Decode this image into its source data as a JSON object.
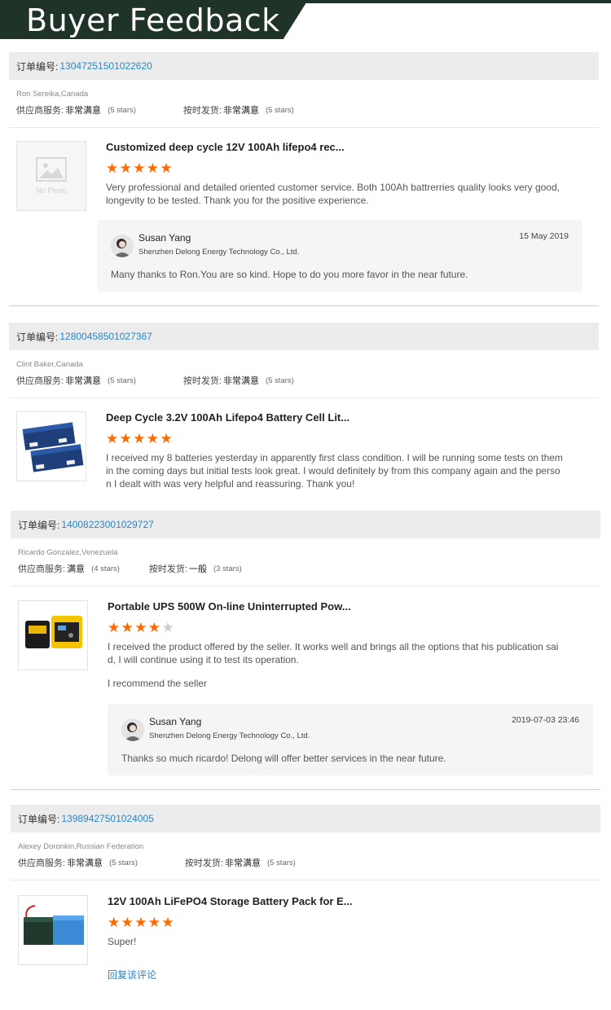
{
  "banner": {
    "title": "Buyer Feedback"
  },
  "order_label": "订单编号:",
  "supplier_label": "供应商服务:",
  "ontime_label": "按时发货:",
  "orders": [
    {
      "order_no": "13047251501022620",
      "buyer": "Ron Sereika,Canada",
      "service": "非常满意",
      "service_stars": "(5 stars)",
      "shipping": "非常满意",
      "shipping_stars": "(5 stars)",
      "product_title": "Customized deep cycle 12V 100Ah lifepo4 rec...",
      "rating": 5,
      "text": "Very professional and detailed oriented customer service. Both 100Ah battrerries quality looks very good, longevity to be tested. Thank you for the positive experience.",
      "no_photo": "No Photo",
      "reply": {
        "name": "Susan Yang",
        "company": "Shenzhen Delong Energy Technology Co., Ltd.",
        "date": "15 May 2019",
        "message": "Many thanks to Ron.You are so kind. Hope to do you more favor in the near future."
      }
    },
    {
      "order_no": "12800458501027367",
      "buyer": "Clint Baker,Canada",
      "service": "非常满意",
      "service_stars": "(5 stars)",
      "shipping": "非常满意",
      "shipping_stars": "(5 stars)",
      "product_title": "Deep Cycle 3.2V 100Ah Lifepo4 Battery Cell Lit...",
      "rating": 5,
      "text": "I received my 8 batteries yesterday in apparently first class condition. I will be running some tests on them in the coming days but initial tests look great. I would definitely by from this company again and the person I dealt with was very helpful and reassuring. Thank you!"
    },
    {
      "order_no": "14008223001029727",
      "buyer": "Ricardo Gonzalez,Venezuela",
      "service": "满意",
      "service_stars": "(4 stars)",
      "shipping": "一般",
      "shipping_stars": "(3 stars)",
      "product_title": "Portable UPS 500W On-line Uninterrupted Pow...",
      "rating": 4,
      "text": "I received the product offered by the seller. It works well and brings all the options that his publication said, I will continue using it to test its operation.",
      "text2": "I recommend the seller",
      "reply": {
        "name": "Susan Yang",
        "company": "Shenzhen Delong Energy Technology Co., Ltd.",
        "date": "2019-07-03 23:46",
        "message": "Thanks so much ricardo! Delong will offer better services in the near future."
      }
    },
    {
      "order_no": "13989427501024005",
      "buyer": "Alexey Doronkin,Russian Federation",
      "service": "非常满意",
      "service_stars": "(5 stars)",
      "shipping": "非常满意",
      "shipping_stars": "(5 stars)",
      "product_title": "12V 100Ah LiFePO4 Storage Battery Pack for E...",
      "rating": 5,
      "text": "Super!",
      "reply_link": "回复该评论"
    }
  ],
  "colors": {
    "banner": "#1f3328",
    "link": "#2a86c8",
    "star_on": "#ff6a00",
    "star_off": "#cccccc"
  }
}
